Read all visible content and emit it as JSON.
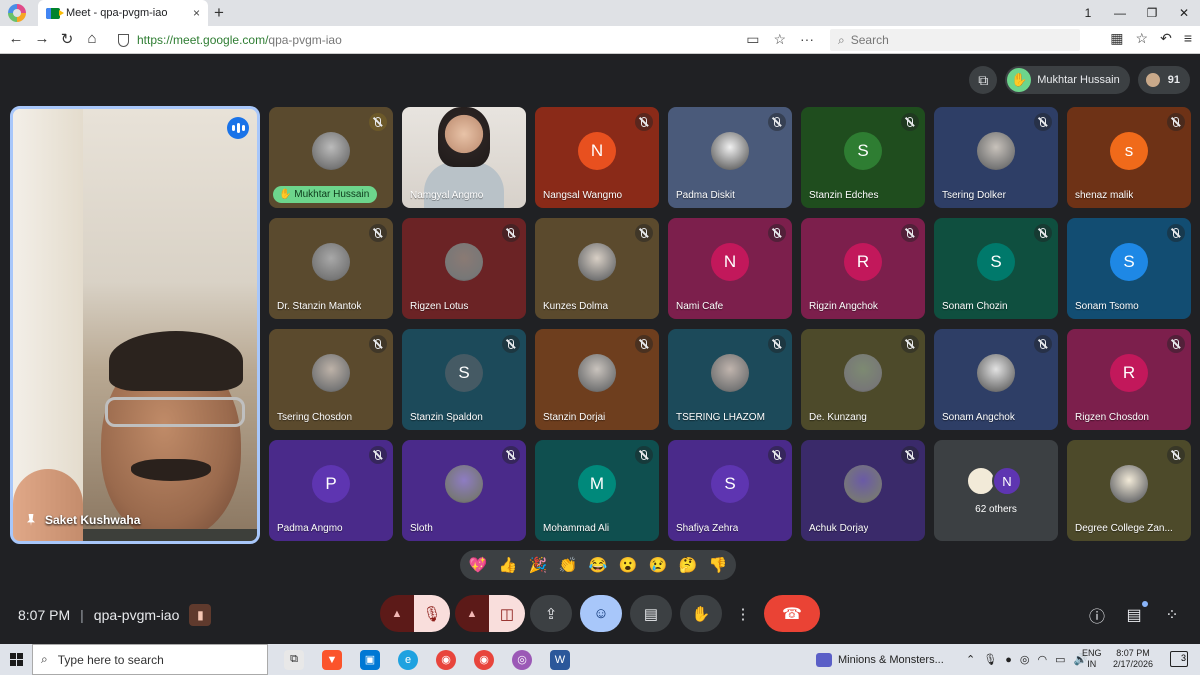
{
  "browser": {
    "tab_title": "Meet - qpa-pvgm-iao",
    "tab_close": "×",
    "new_tab": "+",
    "url_host": "https://meet.google.com/",
    "url_path": "qpa-pvgm-iao",
    "search_placeholder": "Search",
    "window_controls": [
      "1",
      "—",
      "❐",
      "✕"
    ]
  },
  "meet": {
    "raised_hand_name": "Mukhtar Hussain",
    "participant_count": "91",
    "main_speaker": "Saket Kushwaha",
    "meeting_time": "8:07 PM",
    "meeting_code": "qpa-pvgm-iao",
    "separator": "|"
  },
  "tiles": [
    {
      "name": "Mukhtar Hussain",
      "type": "photo",
      "bg": "#5a4a2e",
      "mute_color": "#d6c07a",
      "raised": true
    },
    {
      "name": "Namgyal Angmo",
      "type": "video",
      "bg": "#e6e1dc"
    },
    {
      "name": "Nangsal Wangmo",
      "type": "letter",
      "letter": "N",
      "bg": "#8a2a18",
      "avatar": "#e8501f"
    },
    {
      "name": "Padma Diskit",
      "type": "photo",
      "bg": "#4a5a7a",
      "avatar": "#f0f0f0"
    },
    {
      "name": "Stanzin Edches",
      "type": "letter",
      "letter": "S",
      "bg": "#1f4d1e",
      "avatar": "#2e7d32"
    },
    {
      "name": "Tsering Dolker",
      "type": "photo",
      "bg": "#2e3e66",
      "avatar": "#c8c2bb"
    },
    {
      "name": "shenaz malik",
      "type": "letter",
      "letter": "s",
      "bg": "#6e3216",
      "avatar": "#f06a1a"
    },
    {
      "name": "Dr. Stanzin Mantok",
      "type": "photo",
      "bg": "#5a4a2e",
      "avatar": "#a8a8a8"
    },
    {
      "name": "Rigzen Lotus",
      "type": "photo",
      "bg": "#6b2325",
      "avatar": "#8a7a74"
    },
    {
      "name": "Kunzes Dolma",
      "type": "photo",
      "bg": "#5b4a2d",
      "avatar": "#d8cfc5"
    },
    {
      "name": "Nami Cafe",
      "type": "letter",
      "letter": "N",
      "bg": "#7c1f4c",
      "avatar": "#c2185b"
    },
    {
      "name": "Rigzin Angchok",
      "type": "letter",
      "letter": "R",
      "bg": "#7c1f4c",
      "avatar": "#c2185b"
    },
    {
      "name": "Sonam Chozin",
      "type": "letter",
      "letter": "S",
      "bg": "#0f4f3f",
      "avatar": "#00796b"
    },
    {
      "name": "Sonam Tsomo",
      "type": "letter",
      "letter": "S",
      "bg": "#124d72",
      "avatar": "#1e88e5"
    },
    {
      "name": "Tsering Chosdon",
      "type": "photo",
      "bg": "#5b4a2d",
      "avatar": "#bdb2a8"
    },
    {
      "name": "Stanzin Spaldon",
      "type": "letter",
      "letter": "S",
      "bg": "#1c4a5a",
      "avatar": "#455a64"
    },
    {
      "name": "Stanzin Dorjai",
      "type": "photo",
      "bg": "#6e3e1e",
      "avatar": "#c9c3bd"
    },
    {
      "name": "TSERING LHAZOM",
      "type": "photo",
      "bg": "#1c4a5a",
      "avatar": "#c0b4ad"
    },
    {
      "name": "De. Kunzang",
      "type": "photo",
      "bg": "#4d4a2a",
      "avatar": "#7d8a72"
    },
    {
      "name": "Sonam Angchok",
      "type": "photo",
      "bg": "#2e3e66",
      "avatar": "#e2e2e2"
    },
    {
      "name": "Rigzen Chosdon",
      "type": "letter",
      "letter": "R",
      "bg": "#7c1f4c",
      "avatar": "#c2185b"
    },
    {
      "name": "Padma Angmo",
      "type": "letter",
      "letter": "P",
      "bg": "#4a2a8a",
      "avatar": "#5e35b1"
    },
    {
      "name": "Sloth",
      "type": "photo",
      "bg": "#4a2a8a",
      "avatar": "#8e7cc3"
    },
    {
      "name": "Mohammad Ali",
      "type": "letter",
      "letter": "M",
      "bg": "#0f4f4f",
      "avatar": "#00897b"
    },
    {
      "name": "Shafiya Zehra",
      "type": "letter",
      "letter": "S",
      "bg": "#4a2a8a",
      "avatar": "#5e35b1"
    },
    {
      "name": "Achuk Dorjay",
      "type": "photo",
      "bg": "#3a2a6a",
      "avatar": "#6a5aa6"
    },
    {
      "name": "62 others",
      "type": "others",
      "bg": "#3c4043",
      "letter": "N"
    },
    {
      "name": "Degree College Zan...",
      "type": "photo",
      "bg": "#4d4a2a",
      "avatar": "#f2ead8"
    }
  ],
  "reactions": [
    "💖",
    "👍",
    "🎉",
    "👏",
    "😂",
    "😮",
    "😢",
    "🤔",
    "👎"
  ],
  "taskbar": {
    "search_placeholder": "Type here to search",
    "media_title": "Minions & Monsters...",
    "lang_top": "ENG",
    "lang_bottom": "IN",
    "time": "8:07 PM",
    "date": "2/17/2026",
    "notifications": "3"
  },
  "colors": {
    "meet_bg": "#202124",
    "accent_blue": "#a8c7fa",
    "end_call_red": "#ea4335",
    "raised_hand_green": "#6dd58c"
  }
}
